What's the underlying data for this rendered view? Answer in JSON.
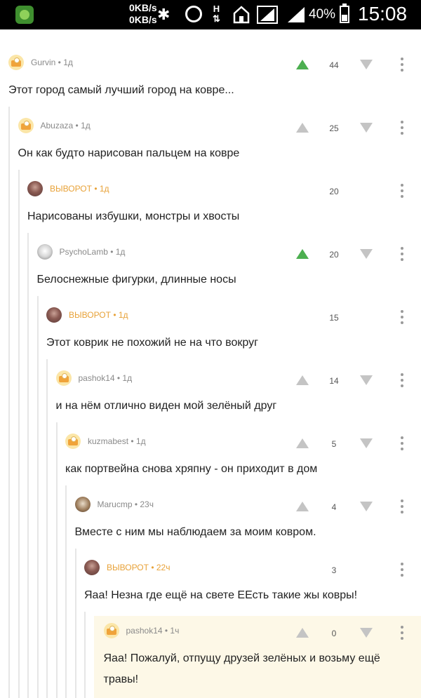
{
  "status_bar": {
    "speed_up": "0KB/s",
    "speed_down": "0KB/s",
    "network_type": "H",
    "battery": "40%",
    "time": "15:08",
    "icons": [
      "app-icon",
      "bluetooth-icon",
      "alarm-icon",
      "network-h-icon",
      "home-icon",
      "signal-icon",
      "signal-icon",
      "battery-icon"
    ]
  },
  "colors": {
    "vote_active": "#4caf50",
    "vote_inactive": "#c4c4c4",
    "author_highlight": "#e8a238",
    "thread_line": "#e6e6e6",
    "highlight_bg": "#fdf8e7"
  },
  "comments": [
    {
      "author": "Gurvin",
      "time": "1д",
      "text": "Этот город самый лучший город на ковре...",
      "score": "44",
      "upvoted": true,
      "votable": true,
      "author_highlight": false,
      "avatar": "default-avatar"
    },
    {
      "author": "Abuzaza",
      "time": "1д",
      "text": "Он как будто нарисован пальцем на ковре",
      "score": "25",
      "upvoted": false,
      "votable": true,
      "author_highlight": false,
      "avatar": "default-avatar"
    },
    {
      "author": "ВЫВОРОТ",
      "time": "1д",
      "text": "Нарисованы избушки, монстры и хвосты",
      "score": "20",
      "upvoted": false,
      "votable": false,
      "author_highlight": true,
      "avatar": "user-photo"
    },
    {
      "author": "PsychoLamb",
      "time": "1д",
      "text": "Белоснежные фигурки, длинные носы",
      "score": "20",
      "upvoted": true,
      "votable": true,
      "author_highlight": false,
      "avatar": "sheep-photo"
    },
    {
      "author": "ВЫВОРОТ",
      "time": "1д",
      "text": "Этот коврик не похожий не на что вокруг",
      "score": "15",
      "upvoted": false,
      "votable": false,
      "author_highlight": true,
      "avatar": "user-photo"
    },
    {
      "author": "pashok14",
      "time": "1д",
      "text": "и на нём отлично виден мой зелёный друг",
      "score": "14",
      "upvoted": false,
      "votable": true,
      "author_highlight": false,
      "avatar": "default-avatar"
    },
    {
      "author": "kuzmabest",
      "time": "1д",
      "text": "как портвейна снова хряпну - он приходит в дом",
      "score": "5",
      "upvoted": false,
      "votable": true,
      "author_highlight": false,
      "avatar": "default-avatar"
    },
    {
      "author": "Marucmp",
      "time": "23ч",
      "text": "Вместе с ним мы наблюдаем за моим ковром.",
      "score": "4",
      "upvoted": false,
      "votable": true,
      "author_highlight": false,
      "avatar": "dog-photo"
    },
    {
      "author": "ВЫВОРОТ",
      "time": "22ч",
      "text": "Яаа! Незна где ещё на свете ЕЕсть такие жы ковры!",
      "score": "3",
      "upvoted": false,
      "votable": false,
      "author_highlight": true,
      "avatar": "user-photo"
    },
    {
      "author": "pashok14",
      "time": "1ч",
      "text": "Яаа! Пожалуй, отпущу друзей зелёных и возьму ещё травы!",
      "score": "0",
      "upvoted": false,
      "votable": true,
      "author_highlight": false,
      "avatar": "default-avatar"
    }
  ]
}
